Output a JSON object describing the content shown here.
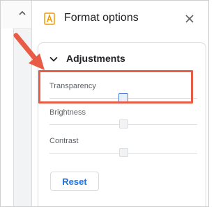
{
  "panel": {
    "title": "Format options",
    "icon": "format-options-icon",
    "close_icon": "close-icon"
  },
  "section": {
    "title": "Adjustments",
    "expanded": true
  },
  "sliders": [
    {
      "label": "Transparency",
      "value": 0.5,
      "active": true
    },
    {
      "label": "Brightness",
      "value": 0.5,
      "active": false
    },
    {
      "label": "Contrast",
      "value": 0.5,
      "active": false
    }
  ],
  "buttons": {
    "reset_label": "Reset"
  },
  "colors": {
    "accent": "#1a73e8",
    "annotation": "#e85b44",
    "icon_orange": "#f29900"
  }
}
